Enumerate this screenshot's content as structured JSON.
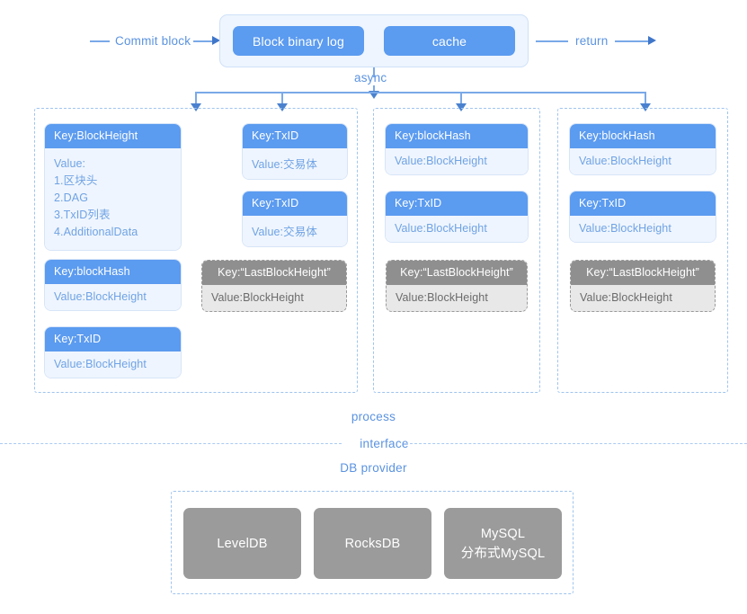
{
  "diagram": {
    "top_flow": {
      "in_label": "Commit block",
      "out_label": "return",
      "async_label": "async",
      "blocks": [
        {
          "label": "Block binary log"
        },
        {
          "label": "cache"
        }
      ]
    },
    "groups": [
      {
        "name": "block-store-group",
        "columns": [
          {
            "name": "block-column",
            "cards": [
              {
                "type": "blue",
                "key": "Key:BlockHeight",
                "value": "Value:\n1.区块头\n2.DAG\n3.TxID列表\n4.AdditionalData",
                "multiline": true
              },
              {
                "type": "blue",
                "key": "Key:blockHash",
                "value": "Value:BlockHeight",
                "multiline": false
              },
              {
                "type": "blue",
                "key": "Key:TxID",
                "value": "Value:BlockHeight",
                "multiline": false
              }
            ]
          },
          {
            "name": "tx-column",
            "cards": [
              {
                "type": "blue",
                "key": "Key:TxID",
                "value": "Value:交易体",
                "multiline": false
              },
              {
                "type": "blue",
                "key": "Key:TxID",
                "value": "Value:交易体",
                "multiline": false
              },
              {
                "type": "gray",
                "key": "Key:“LastBlockHeight”",
                "value": "Value:BlockHeight",
                "multiline": false
              }
            ]
          }
        ]
      },
      {
        "name": "blockhash-index-group",
        "columns": [
          {
            "name": "blockhash-index-column",
            "cards": [
              {
                "type": "blue",
                "key": "Key:blockHash",
                "value": "Value:BlockHeight",
                "multiline": false
              },
              {
                "type": "blue",
                "key": "Key:TxID",
                "value": "Value:BlockHeight",
                "multiline": false
              },
              {
                "type": "gray",
                "key": "Key:“LastBlockHeight”",
                "value": "Value:BlockHeight",
                "multiline": false
              }
            ]
          }
        ]
      },
      {
        "name": "txid-index-group",
        "columns": [
          {
            "name": "txid-index-column",
            "cards": [
              {
                "type": "blue",
                "key": "Key:blockHash",
                "value": "Value:BlockHeight",
                "multiline": false
              },
              {
                "type": "blue",
                "key": "Key:TxID",
                "value": "Value:BlockHeight",
                "multiline": false
              },
              {
                "type": "gray",
                "key": "Key:“LastBlockHeight”",
                "value": "Value:BlockHeight",
                "multiline": false
              }
            ]
          }
        ]
      }
    ],
    "layers": {
      "process": "process",
      "interface": "interface",
      "db_provider": "DB provider"
    },
    "db_providers": [
      {
        "label": "LevelDB"
      },
      {
        "label": "RocksDB"
      },
      {
        "label": "MySQL\n分布式MySQL"
      }
    ]
  },
  "colors": {
    "accent_blue": "#5b9bf0",
    "light_blue_fill": "#eff5fe",
    "text_blue": "#5b93e0",
    "dashed_blue": "#9fc4ef",
    "gray_header": "#8f8f8f",
    "gray_fill": "#e8e8e8",
    "db_gray": "#9b9b9b"
  }
}
